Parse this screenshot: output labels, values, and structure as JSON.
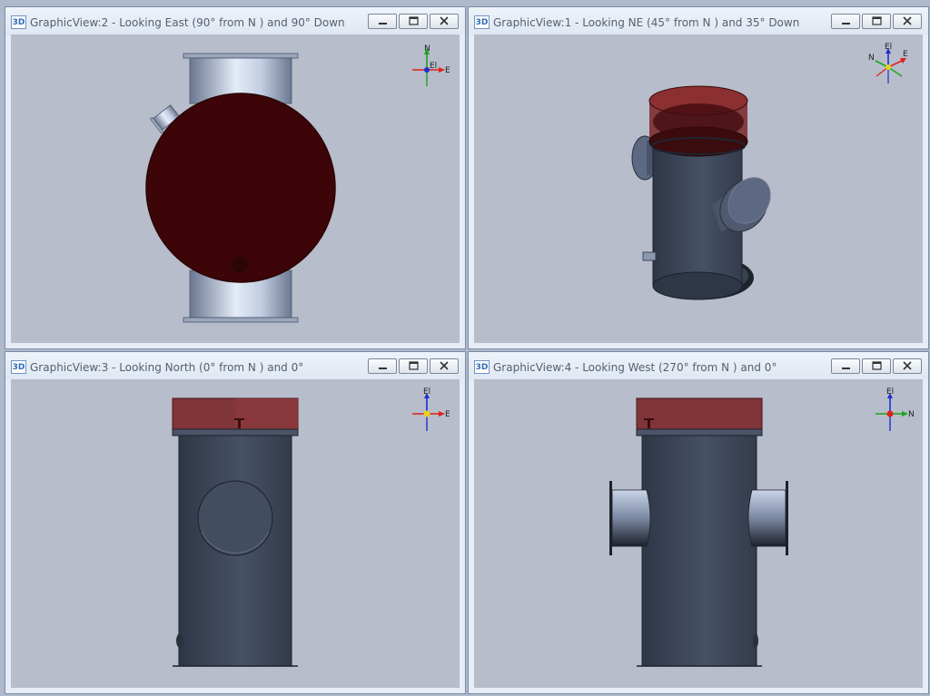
{
  "panes": [
    {
      "badge": "3D",
      "title": "GraphicView:2 - Looking East (90° from N ) and 90° Down",
      "triad": {
        "up": "N",
        "right": "E",
        "left": "",
        "center": "El"
      }
    },
    {
      "badge": "3D",
      "title": "GraphicView:1 - Looking NE (45° from N ) and 35° Down",
      "triad": {
        "up": "El",
        "right": "E",
        "left": "N",
        "center": ""
      }
    },
    {
      "badge": "3D",
      "title": "GraphicView:3 - Looking North (0° from N ) and 0°",
      "triad": {
        "up": "El",
        "right": "E",
        "left": "",
        "center": ""
      }
    },
    {
      "badge": "3D",
      "title": "GraphicView:4 - Looking West (270° from N ) and 0°",
      "triad": {
        "up": "El",
        "right": "N",
        "left": "",
        "center": ""
      }
    }
  ],
  "colors": {
    "viewport": "#b7bdca",
    "vessel_steel": "#3c4556",
    "vessel_highlight": "#c7d3e8",
    "cap_transparent": "#7a2628",
    "axis_x": "#e0201e",
    "axis_y": "#1aa61a",
    "axis_z": "#1d2fd0"
  },
  "icons": [
    "minimize-icon",
    "restore-icon",
    "close-icon",
    "axis-triad-icon"
  ]
}
